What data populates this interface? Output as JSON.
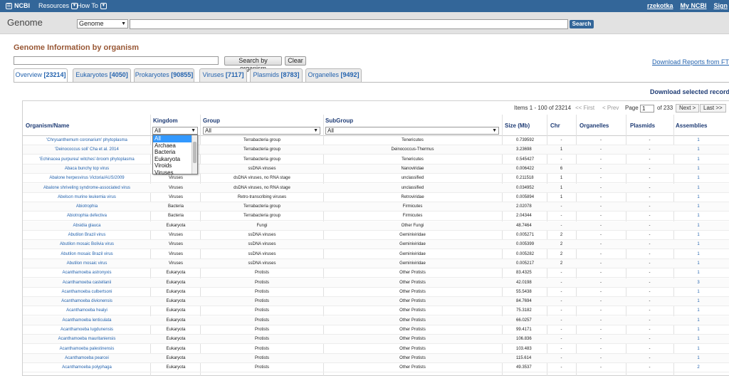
{
  "topbar": {
    "logo": "NCBI",
    "resources": "Resources",
    "howto": "How To",
    "user": "rzekotka",
    "myncbi": "My NCBI",
    "signout": "Sign"
  },
  "search": {
    "db_name": "Genome",
    "db_selected": "Genome",
    "button": "Search"
  },
  "page": {
    "title": "Genome Information by organism",
    "search_button": "Search by organism",
    "clear_button": "Clear",
    "download_ftp": "Download Reports from FTP s",
    "download_selected": "Download selected records"
  },
  "tabs": [
    {
      "label": "Overview",
      "count": "[23214]"
    },
    {
      "label": "Eukaryotes",
      "count": "[4050]"
    },
    {
      "label": "Prokaryotes",
      "count": "[90855]"
    },
    {
      "label": "Viruses",
      "count": "[7117]"
    },
    {
      "label": "Plasmids",
      "count": "[8783]"
    },
    {
      "label": "Organelles",
      "count": "[9492]"
    }
  ],
  "pager": {
    "items": "Items 1 - 100 of 23214",
    "first": "<< First",
    "prev": "< Prev",
    "page_label": "Page",
    "page_value": "1",
    "of": "of 233",
    "next": "Next >",
    "last": "Last >>"
  },
  "columns": {
    "organism": "Organism/Name",
    "kingdom": "Kingdom",
    "group": "Group",
    "subgroup": "SubGroup",
    "size": "Size (Mb)",
    "chr": "Chr",
    "organelles": "Organelles",
    "plasmids": "Plasmids",
    "assemblies": "Assemblies"
  },
  "filters": {
    "kingdom": "All",
    "group": "All",
    "subgroup": "All"
  },
  "kingdom_options": [
    "All",
    "Archaea",
    "Bacteria",
    "Eukaryota",
    "Viroids",
    "Viruses"
  ],
  "rows": [
    {
      "org": "'Chrysanthemum coronarium' phytoplasma",
      "kd": "",
      "gp": "Terrabacteria group",
      "sg": "Tenericutes",
      "sz": "0.739592",
      "chr": "-",
      "ogl": "-",
      "pl": "-",
      "asm": "1"
    },
    {
      "org": "'Deinococcus soli' Cha et al. 2014",
      "kd": "",
      "gp": "Terrabacteria group",
      "sg": "Deinococcus-Thermus",
      "sz": "3.23698",
      "chr": "1",
      "ogl": "-",
      "pl": "-",
      "asm": "1"
    },
    {
      "org": "'Echinacea purpurea' witches'-broom phytoplasma",
      "kd": "",
      "gp": "Terrabacteria group",
      "sg": "Tenericutes",
      "sz": "0.545427",
      "chr": "-",
      "ogl": "-",
      "pl": "-",
      "asm": "1"
    },
    {
      "org": "Abaca bunchy top virus",
      "kd": "",
      "gp": "ssDNA viruses",
      "sg": "Nanoviridae",
      "sz": "0.006422",
      "chr": "6",
      "ogl": "-",
      "pl": "-",
      "asm": "1"
    },
    {
      "org": "Abalone herpesvirus Victoria/AUS/2009",
      "kd": "Viruses",
      "gp": "dsDNA viruses, no RNA stage",
      "sg": "unclassified",
      "sz": "0.211518",
      "chr": "1",
      "ogl": "-",
      "pl": "-",
      "asm": "1"
    },
    {
      "org": "Abalone shriveling syndrome-associated virus",
      "kd": "Viruses",
      "gp": "dsDNA viruses, no RNA stage",
      "sg": "unclassified",
      "sz": "0.034952",
      "chr": "1",
      "ogl": "-",
      "pl": "-",
      "asm": "1"
    },
    {
      "org": "Abelson murine leukemia virus",
      "kd": "Viruses",
      "gp": "Retro-transcribing viruses",
      "sg": "Retroviridae",
      "sz": "0.005894",
      "chr": "1",
      "ogl": "-",
      "pl": "-",
      "asm": "1"
    },
    {
      "org": "Abiotrophia",
      "kd": "Bacteria",
      "gp": "Terrabacteria group",
      "sg": "Firmicutes",
      "sz": "2.02078",
      "chr": "-",
      "ogl": "-",
      "pl": "-",
      "asm": "1"
    },
    {
      "org": "Abiotrophia defectiva",
      "kd": "Bacteria",
      "gp": "Terrabacteria group",
      "sg": "Firmicutes",
      "sz": "2.04344",
      "chr": "-",
      "ogl": "-",
      "pl": "-",
      "asm": "1"
    },
    {
      "org": "Absidia glauca",
      "kd": "Eukaryota",
      "gp": "Fungi",
      "sg": "Other Fungi",
      "sz": "48.7464",
      "chr": "-",
      "ogl": "-",
      "pl": "-",
      "asm": "1"
    },
    {
      "org": "Abutilon Brazil virus",
      "kd": "Viruses",
      "gp": "ssDNA viruses",
      "sg": "Geminiviridae",
      "sz": "0.005271",
      "chr": "2",
      "ogl": "-",
      "pl": "-",
      "asm": "1"
    },
    {
      "org": "Abutilon mosaic Bolivia virus",
      "kd": "Viruses",
      "gp": "ssDNA viruses",
      "sg": "Geminiviridae",
      "sz": "0.005399",
      "chr": "2",
      "ogl": "-",
      "pl": "-",
      "asm": "1"
    },
    {
      "org": "Abutilon mosaic Brazil virus",
      "kd": "Viruses",
      "gp": "ssDNA viruses",
      "sg": "Geminiviridae",
      "sz": "0.005282",
      "chr": "2",
      "ogl": "-",
      "pl": "-",
      "asm": "1"
    },
    {
      "org": "Abutilon mosaic virus",
      "kd": "Viruses",
      "gp": "ssDNA viruses",
      "sg": "Geminiviridae",
      "sz": "0.005217",
      "chr": "2",
      "ogl": "-",
      "pl": "-",
      "asm": "1"
    },
    {
      "org": "Acanthamoeba astronyxis",
      "kd": "Eukaryota",
      "gp": "Protists",
      "sg": "Other Protists",
      "sz": "83.4325",
      "chr": "-",
      "ogl": "-",
      "pl": "-",
      "asm": "1"
    },
    {
      "org": "Acanthamoeba castellanii",
      "kd": "Eukaryota",
      "gp": "Protists",
      "sg": "Other Protists",
      "sz": "42.0198",
      "chr": "-",
      "ogl": "-",
      "pl": "-",
      "asm": "3"
    },
    {
      "org": "Acanthamoeba culbertsoni",
      "kd": "Eukaryota",
      "gp": "Protists",
      "sg": "Other Protists",
      "sz": "55.5438",
      "chr": "-",
      "ogl": "-",
      "pl": "-",
      "asm": "1"
    },
    {
      "org": "Acanthamoeba divionensis",
      "kd": "Eukaryota",
      "gp": "Protists",
      "sg": "Other Protists",
      "sz": "84.7694",
      "chr": "-",
      "ogl": "-",
      "pl": "-",
      "asm": "1"
    },
    {
      "org": "Acanthamoeba healyi",
      "kd": "Eukaryota",
      "gp": "Protists",
      "sg": "Other Protists",
      "sz": "75.3182",
      "chr": "-",
      "ogl": "-",
      "pl": "-",
      "asm": "1"
    },
    {
      "org": "Acanthamoeba lenticulata",
      "kd": "Eukaryota",
      "gp": "Protists",
      "sg": "Other Protists",
      "sz": "66.0257",
      "chr": "-",
      "ogl": "-",
      "pl": "-",
      "asm": "1"
    },
    {
      "org": "Acanthamoeba lugdunensis",
      "kd": "Eukaryota",
      "gp": "Protists",
      "sg": "Other Protists",
      "sz": "99.4171",
      "chr": "-",
      "ogl": "-",
      "pl": "-",
      "asm": "1"
    },
    {
      "org": "Acanthamoeba mauritaniensis",
      "kd": "Eukaryota",
      "gp": "Protists",
      "sg": "Other Protists",
      "sz": "106.836",
      "chr": "-",
      "ogl": "-",
      "pl": "-",
      "asm": "1"
    },
    {
      "org": "Acanthamoeba palestinensis",
      "kd": "Eukaryota",
      "gp": "Protists",
      "sg": "Other Protists",
      "sz": "103.483",
      "chr": "-",
      "ogl": "-",
      "pl": "-",
      "asm": "1"
    },
    {
      "org": "Acanthamoeba pearcei",
      "kd": "Eukaryota",
      "gp": "Protists",
      "sg": "Other Protists",
      "sz": "115.614",
      "chr": "-",
      "ogl": "-",
      "pl": "-",
      "asm": "1"
    },
    {
      "org": "Acanthamoeba polyphaga",
      "kd": "Eukaryota",
      "gp": "Protists",
      "sg": "Other Protists",
      "sz": "49.3537",
      "chr": "-",
      "ogl": "-",
      "pl": "-",
      "asm": "2"
    }
  ]
}
